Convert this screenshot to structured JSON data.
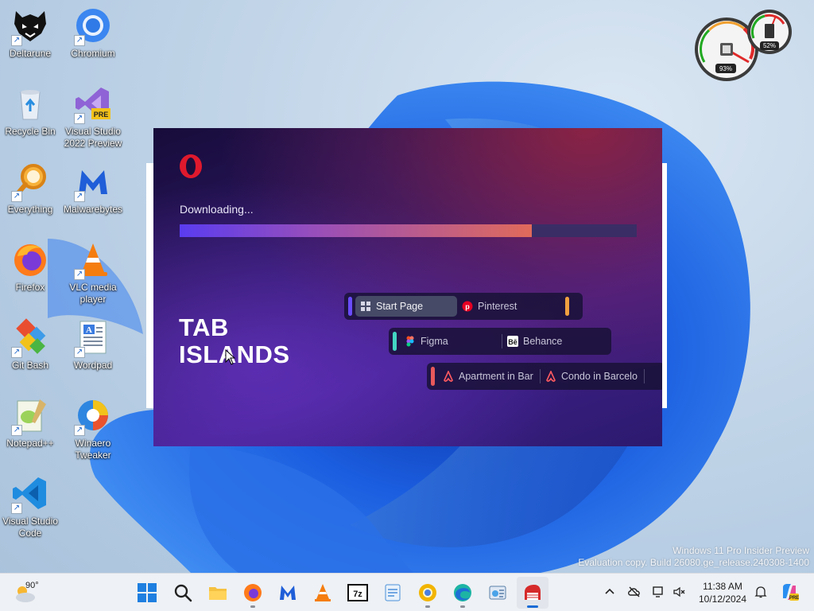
{
  "desktop": {
    "icons": [
      {
        "name": "Deltarune",
        "label": "Deltarune"
      },
      {
        "name": "Chromium",
        "label": "Chromium"
      },
      {
        "name": "Recycle Bin",
        "label": "Recycle Bin"
      },
      {
        "name": "Visual Studio 2022 Preview",
        "label": "Visual Studio 2022 Preview",
        "badge": "PRE"
      },
      {
        "name": "Everything",
        "label": "Everything"
      },
      {
        "name": "Malwarebytes",
        "label": "Malwarebytes"
      },
      {
        "name": "Firefox",
        "label": "Firefox"
      },
      {
        "name": "VLC media player",
        "label": "VLC media player"
      },
      {
        "name": "Git Bash",
        "label": "Git Bash"
      },
      {
        "name": "Wordpad",
        "label": "Wordpad"
      },
      {
        "name": "Notepad++",
        "label": "Notepad++"
      },
      {
        "name": "Winaero Tweaker",
        "label": "Winaero Tweaker"
      },
      {
        "name": "Visual Studio Code",
        "label": "Visual Studio Code"
      }
    ]
  },
  "gadget": {
    "cpu_percent": "93%",
    "memory_percent": "52%"
  },
  "installer": {
    "status": "Downloading...",
    "progress": 0.77,
    "hero_line1": "TAB",
    "hero_line2": "ISLANDS",
    "rows": [
      {
        "tabs": [
          "Start Page",
          "Pinterest"
        ]
      },
      {
        "tabs": [
          "Figma",
          "Behance"
        ]
      },
      {
        "tabs": [
          "Apartment in Bar",
          "Condo in Barcelo"
        ]
      }
    ],
    "colors": {
      "accent_start": "#5a3cf0",
      "accent_end": "#e06a5a",
      "island_purple": "#6a4cff",
      "island_orange": "#f0a040",
      "island_teal": "#43d6c2",
      "island_red": "#e8585a"
    }
  },
  "watermark": {
    "line1": "Windows 11 Pro Insider Preview",
    "line2": "Evaluation copy. Build 26080.ge_release.240308-1400"
  },
  "taskbar": {
    "weather_temp": "90°",
    "apps": [
      "start-icon",
      "search-icon",
      "file-explorer-icon",
      "firefox-icon",
      "malwarebytes-icon",
      "vlc-icon",
      "7zip-icon",
      "notepad-icon",
      "chromium-canary-icon",
      "edge-icon",
      "control-panel-icon",
      "opera-installer-icon"
    ],
    "clock_time": "11:38 AM",
    "clock_date": "10/12/2024"
  }
}
